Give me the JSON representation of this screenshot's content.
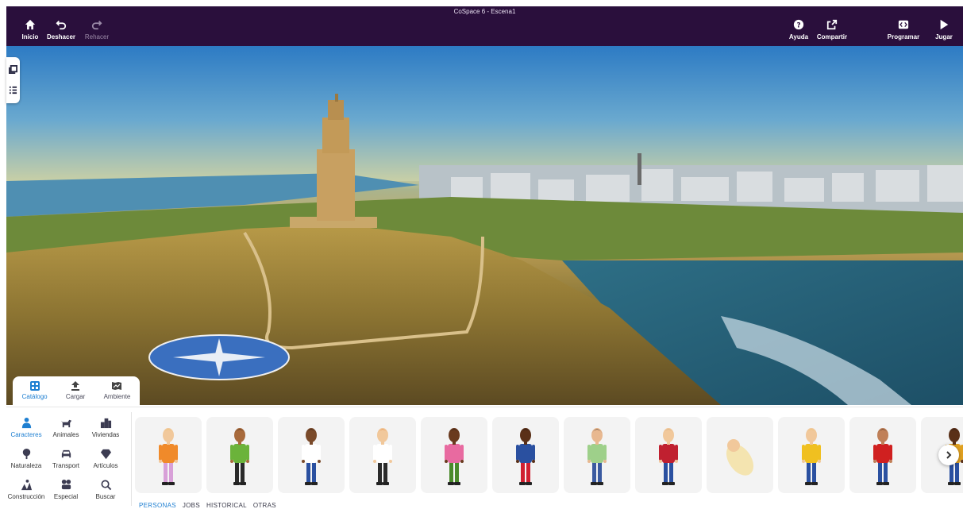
{
  "window": {
    "title": "CoSpace 6 - Escena1"
  },
  "toolbar": {
    "home_label": "Inicio",
    "undo_label": "Deshacer",
    "redo_label": "Rehacer",
    "help_label": "Ayuda",
    "share_label": "Compartir",
    "code_label": "Programar",
    "play_label": "Jugar"
  },
  "panel_tabs": [
    {
      "label": "Catálogo",
      "icon": "catalog-icon",
      "active": true
    },
    {
      "label": "Cargar",
      "icon": "upload-icon",
      "active": false
    },
    {
      "label": "Ambiente",
      "icon": "environment-icon",
      "active": false
    }
  ],
  "categories": [
    {
      "label": "Caracteres",
      "icon": "person-icon",
      "active": true
    },
    {
      "label": "Animales",
      "icon": "dog-icon",
      "active": false
    },
    {
      "label": "Viviendas",
      "icon": "building-icon",
      "active": false
    },
    {
      "label": "Naturaleza",
      "icon": "nature-icon",
      "active": false
    },
    {
      "label": "Transport",
      "icon": "car-icon",
      "active": false
    },
    {
      "label": "Artículos",
      "icon": "gem-icon",
      "active": false
    },
    {
      "label": "Construcción",
      "icon": "construction-icon",
      "active": false
    },
    {
      "label": "Especial",
      "icon": "special-icon",
      "active": false
    },
    {
      "label": "Buscar",
      "icon": "search-icon",
      "active": false
    }
  ],
  "subtabs": [
    {
      "label": "PERSONAS",
      "active": true
    },
    {
      "label": "JOBS",
      "active": false
    },
    {
      "label": "HISTORICAL",
      "active": false
    },
    {
      "label": "OTRAS",
      "active": false
    }
  ],
  "characters": [
    {
      "skin": "#f1c89b",
      "hair": "#e8c060",
      "shirt": "#f08a2a",
      "pants": "#d8a0d8"
    },
    {
      "skin": "#a86a3c",
      "hair": "#2a1a10",
      "shirt": "#6bb33a",
      "pants": "#2a2a2a"
    },
    {
      "skin": "#7a4a2a",
      "hair": "#1a1010",
      "shirt": "#ffffff",
      "pants": "#2a50a0"
    },
    {
      "skin": "#f1c89b",
      "hair": "#e07a30",
      "shirt": "#ffffff",
      "pants": "#2a2a2a"
    },
    {
      "skin": "#6a3a1e",
      "hair": "#1a1010",
      "shirt": "#e86aa0",
      "pants": "#4a8a2a"
    },
    {
      "skin": "#5a3018",
      "hair": "#1a1010",
      "shirt": "#2a50a0",
      "pants": "#d02030"
    },
    {
      "skin": "#e8b890",
      "hair": "#2a1a10",
      "shirt": "#9ed08a",
      "pants": "#3a5aa0"
    },
    {
      "skin": "#f1c89b",
      "hair": "#c8a070",
      "shirt": "#c02030",
      "pants": "#2a50a0"
    },
    {
      "skin": "#f1c89b",
      "hair": "#f1c89b",
      "shirt": "#f4e4b0",
      "pants": "#f4e4b0"
    },
    {
      "skin": "#f1c89b",
      "hair": "#e8c060",
      "shirt": "#f0c020",
      "pants": "#2a50a0"
    },
    {
      "skin": "#c08058",
      "hair": "#2a1a10",
      "shirt": "#d02020",
      "pants": "#2a50a0"
    },
    {
      "skin": "#5a3018",
      "hair": "#1a1010",
      "shirt": "#e0a020",
      "pants": "#2a50a0"
    }
  ],
  "colors": {
    "topbar": "#2a0f3c",
    "accent": "#1e7fd1"
  }
}
